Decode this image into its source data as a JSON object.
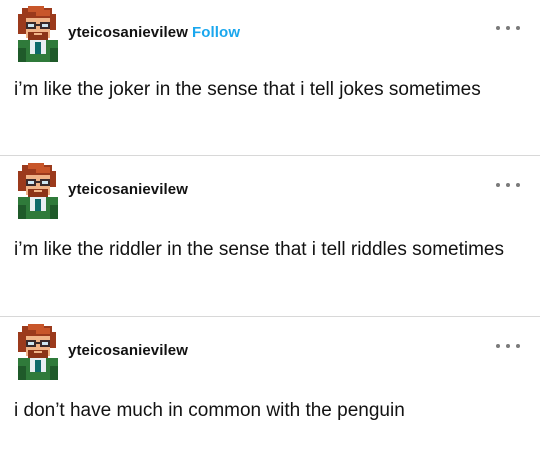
{
  "posts": [
    {
      "username": "yteicosanievilew",
      "follow_label": "Follow",
      "text": "i’m like the joker in the sense that i tell jokes sometimes",
      "avatar_icon": "pixel-character-avatar",
      "more_icon": "more-options-icon"
    },
    {
      "username": "yteicosanievilew",
      "text": "i’m like the riddler in the sense that i tell riddles sometimes",
      "avatar_icon": "pixel-character-avatar",
      "more_icon": "more-options-icon"
    },
    {
      "username": "yteicosanievilew",
      "text": "i don’t have much in common with the penguin",
      "avatar_icon": "pixel-character-avatar",
      "more_icon": "more-options-icon"
    }
  ],
  "colors": {
    "follow": "#1aa7ee",
    "text": "#121212",
    "divider": "#d8d8d8",
    "more_dots": "#7a7a7a"
  }
}
